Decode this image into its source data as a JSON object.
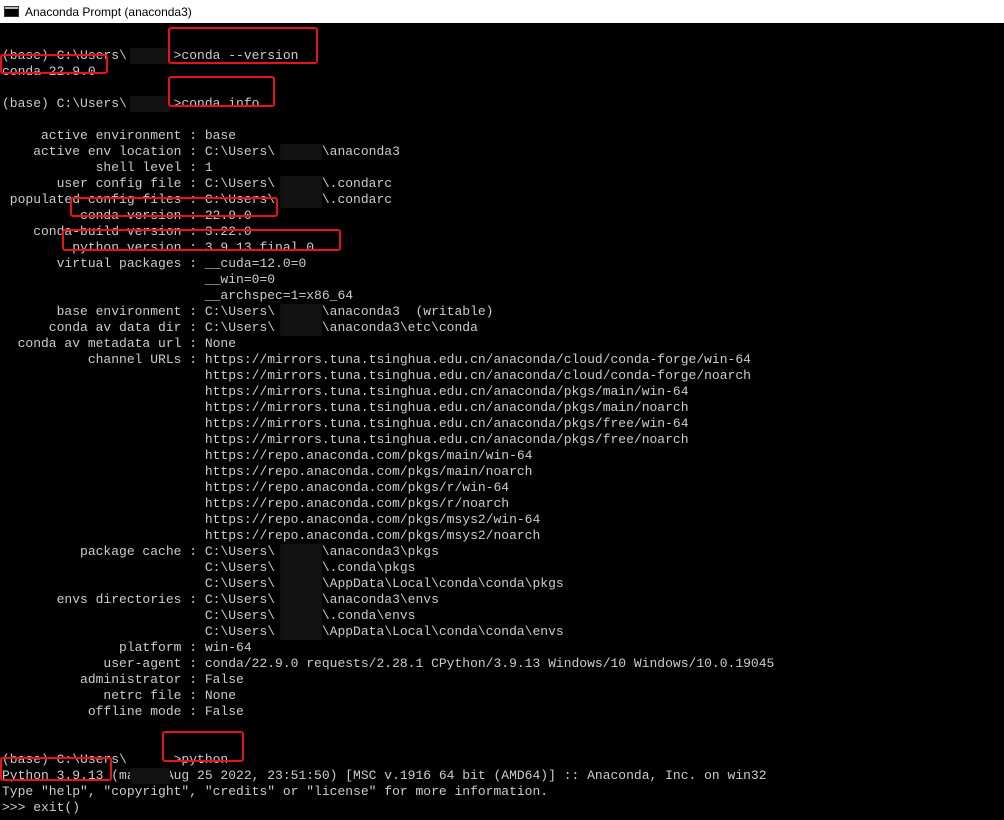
{
  "window": {
    "title": "Anaconda Prompt (anaconda3)",
    "icon": "console-window-icon"
  },
  "console": {
    "lines": [
      "",
      "(base) C:\\Users\\      >conda --version",
      "conda 22.9.0",
      "",
      "(base) C:\\Users\\      >conda info",
      "",
      "     active environment : base",
      "    active env location : C:\\Users\\      \\anaconda3",
      "            shell level : 1",
      "       user config file : C:\\Users\\      \\.condarc",
      " populated config files : C:\\Users\\      \\.condarc",
      "          conda version : 22.9.0",
      "    conda-build version : 3.22.0",
      "         python version : 3.9.13.final.0",
      "       virtual packages : __cuda=12.0=0",
      "                          __win=0=0",
      "                          __archspec=1=x86_64",
      "       base environment : C:\\Users\\      \\anaconda3  (writable)",
      "      conda av data dir : C:\\Users\\      \\anaconda3\\etc\\conda",
      "  conda av metadata url : None",
      "           channel URLs : https://mirrors.tuna.tsinghua.edu.cn/anaconda/cloud/conda-forge/win-64",
      "                          https://mirrors.tuna.tsinghua.edu.cn/anaconda/cloud/conda-forge/noarch",
      "                          https://mirrors.tuna.tsinghua.edu.cn/anaconda/pkgs/main/win-64",
      "                          https://mirrors.tuna.tsinghua.edu.cn/anaconda/pkgs/main/noarch",
      "                          https://mirrors.tuna.tsinghua.edu.cn/anaconda/pkgs/free/win-64",
      "                          https://mirrors.tuna.tsinghua.edu.cn/anaconda/pkgs/free/noarch",
      "                          https://repo.anaconda.com/pkgs/main/win-64",
      "                          https://repo.anaconda.com/pkgs/main/noarch",
      "                          https://repo.anaconda.com/pkgs/r/win-64",
      "                          https://repo.anaconda.com/pkgs/r/noarch",
      "                          https://repo.anaconda.com/pkgs/msys2/win-64",
      "                          https://repo.anaconda.com/pkgs/msys2/noarch",
      "          package cache : C:\\Users\\      \\anaconda3\\pkgs",
      "                          C:\\Users\\      \\.conda\\pkgs",
      "                          C:\\Users\\      \\AppData\\Local\\conda\\conda\\pkgs",
      "       envs directories : C:\\Users\\      \\anaconda3\\envs",
      "                          C:\\Users\\      \\.conda\\envs",
      "                          C:\\Users\\      \\AppData\\Local\\conda\\conda\\envs",
      "               platform : win-64",
      "             user-agent : conda/22.9.0 requests/2.28.1 CPython/3.9.13 Windows/10 Windows/10.0.19045",
      "          administrator : False",
      "             netrc file : None",
      "           offline mode : False",
      "",
      "",
      "(base) C:\\Users\\      >python",
      "Python 3.9.13 (main, Aug 25 2022, 23:51:50) [MSC v.1916 64 bit (AMD64)] :: Anaconda, Inc. on win32",
      "Type \"help\", \"copyright\", \"credits\" or \"license\" for more information.",
      ">>> exit()"
    ]
  },
  "colors": {
    "background": "#000000",
    "text": "#cccccc",
    "highlight": "#e5141b"
  }
}
